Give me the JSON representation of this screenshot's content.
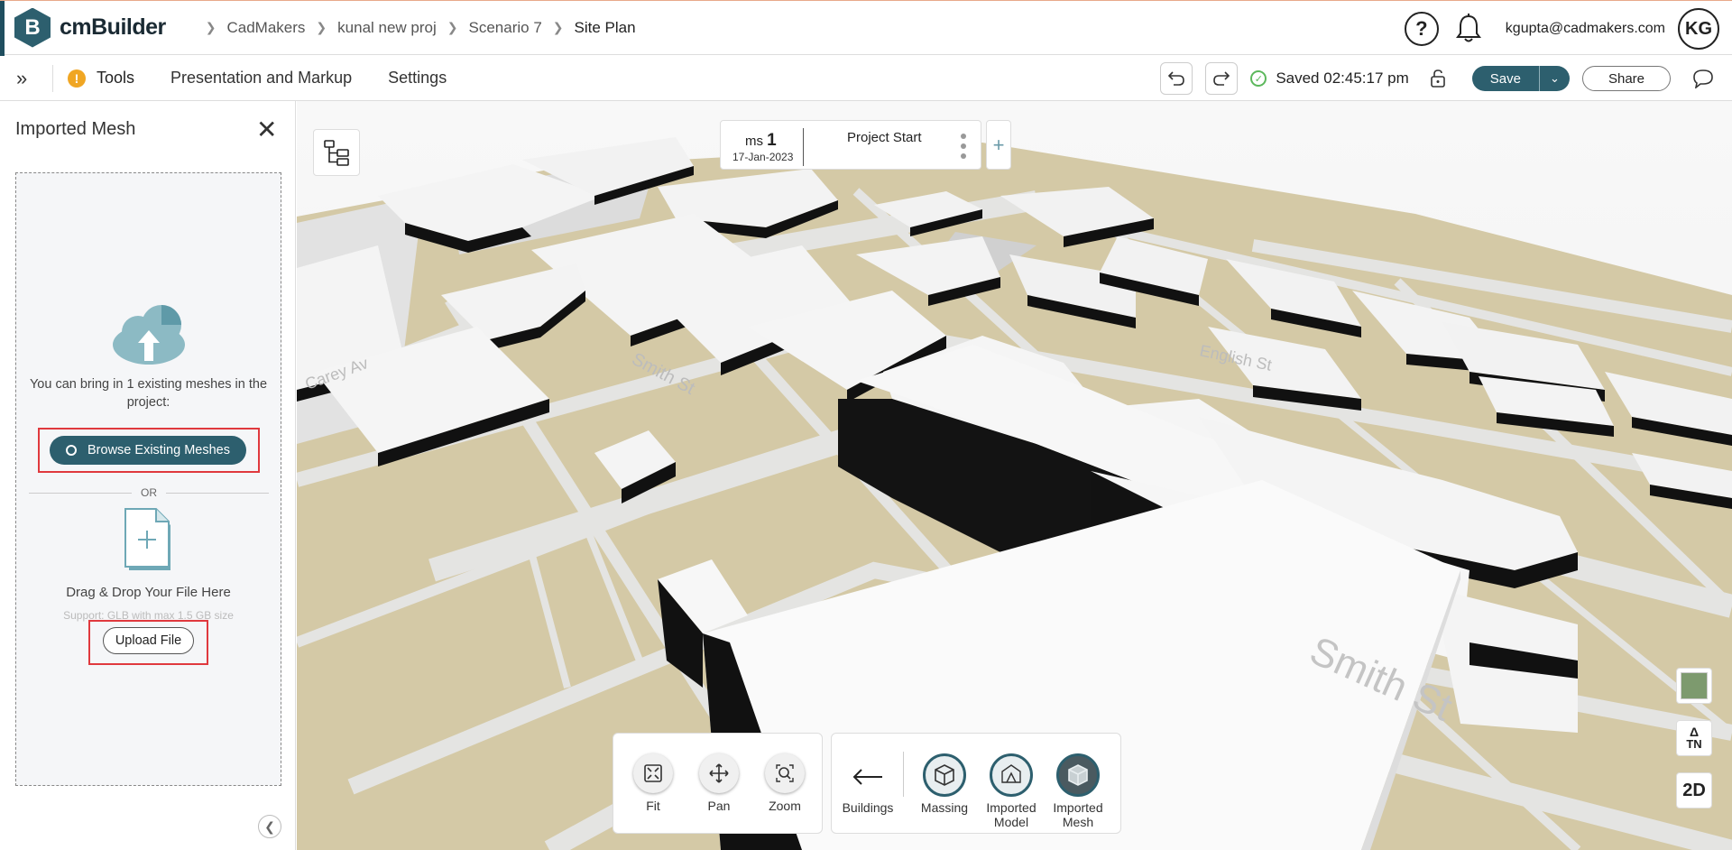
{
  "header": {
    "logo_letter": "B",
    "app_name": "cmBuilder",
    "breadcrumb": [
      "CadMakers",
      "kunal new proj",
      "Scenario 7",
      "Site Plan"
    ],
    "help": "?",
    "email": "kgupta@cadmakers.com",
    "avatar_initials": "KG"
  },
  "toolbar": {
    "tools": "Tools",
    "presentation": "Presentation and Markup",
    "settings": "Settings",
    "saved_status": "Saved 02:45:17 pm",
    "save_label": "Save",
    "share_label": "Share"
  },
  "panel": {
    "title": "Imported Mesh",
    "hint": "You can bring in 1 existing meshes in the project:",
    "browse_label": "Browse Existing Meshes",
    "or_label": "OR",
    "drag_text": "Drag & Drop Your File Here",
    "support_text": "Support: GLB with max 1.5 GB size",
    "upload_label": "Upload File"
  },
  "milestone": {
    "prefix": "ms",
    "number": "1",
    "date": "17-Jan-2023",
    "title": "Project Start"
  },
  "map_labels": {
    "street1": "Smith St",
    "street2": "Smith St",
    "street3": "English St",
    "street4": "Carey Av"
  },
  "nav_tools": [
    {
      "label": "Fit",
      "icon": "fit-icon"
    },
    {
      "label": "Pan",
      "icon": "pan-icon"
    },
    {
      "label": "Zoom",
      "icon": "zoom-icon"
    }
  ],
  "layers": {
    "back": "Buildings",
    "items": [
      "Massing",
      "Imported Model",
      "Imported Mesh"
    ]
  },
  "side_controls": {
    "north": "TN",
    "view_mode": "2D"
  },
  "colors": {
    "brand": "#2d5f6e",
    "highlight": "#e0393e",
    "ground": "#d4c9a6",
    "road": "#e6e6e6"
  }
}
